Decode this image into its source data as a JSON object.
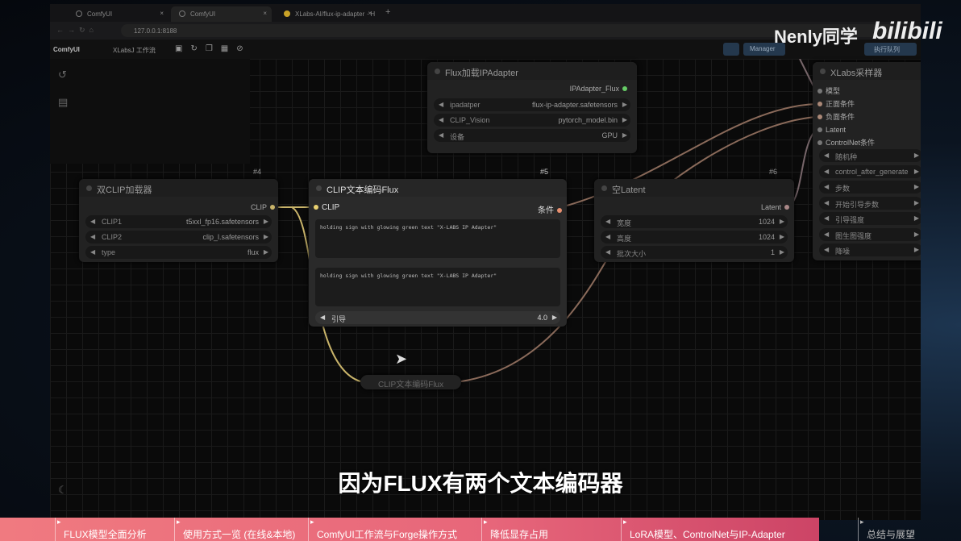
{
  "browser": {
    "tabs": [
      {
        "label": "ComfyUI"
      },
      {
        "label": "ComfyUI"
      },
      {
        "label": "XLabs-AI/flux-ip-adapter · H"
      }
    ],
    "url": "127.0.0.1:8188"
  },
  "menu": {
    "app": "ComfyUI",
    "workflow": "XLabsJ 工作流",
    "manager": "Manager",
    "queue": "执行队列"
  },
  "watermark": {
    "author": "Nenly同学",
    "logo": "bilibili"
  },
  "nodes": {
    "ipadapter": {
      "title": "Flux加载IPAdapter",
      "output": "IPAdapter_Flux",
      "widgets": [
        {
          "label": "ipadatper",
          "value": "flux-ip-adapter.safetensors"
        },
        {
          "label": "CLIP_Vision",
          "value": "pytorch_model.bin"
        },
        {
          "label": "设备",
          "value": "GPU"
        }
      ]
    },
    "dualclip": {
      "id": "#4",
      "title": "双CLIP加载器",
      "output": "CLIP",
      "widgets": [
        {
          "label": "CLIP1",
          "value": "t5xxl_fp16.safetensors"
        },
        {
          "label": "CLIP2",
          "value": "clip_l.safetensors"
        },
        {
          "label": "type",
          "value": "flux"
        }
      ]
    },
    "clipenc": {
      "id": "#5",
      "title": "CLIP文本编码Flux",
      "input": "CLIP",
      "output": "条件",
      "text1": "holding sign with glowing green text \"X-LABS IP Adapter\"",
      "text2": "holding sign with glowing green text \"X-LABS IP Adapter\"",
      "guidance_label": "引导",
      "guidance_value": "4.0"
    },
    "latent": {
      "id": "#6",
      "title": "空Latent",
      "output": "Latent",
      "widgets": [
        {
          "label": "宽度",
          "value": "1024"
        },
        {
          "label": "高度",
          "value": "1024"
        },
        {
          "label": "批次大小",
          "value": "1"
        }
      ]
    },
    "sampler": {
      "title": "XLabs采样器",
      "inputs": [
        "模型",
        "正面条件",
        "负面条件",
        "Latent",
        "ControlNet条件"
      ],
      "widgets": [
        "随机种",
        "control_after_generate",
        "步数",
        "开始引导步数",
        "引导强度",
        "图生图强度",
        "降噪"
      ]
    },
    "collapsed": {
      "title": "CLIP文本编码Flux"
    }
  },
  "subtitle": "因为FLUX有两个文本编码器",
  "chapters": [
    "FLUX模型全面分析",
    "使用方式一览 (在线&本地)",
    "ComfyUI工作流与Forge操作方式",
    "降低显存占用",
    "LoRA模型、ControlNet与IP-Adapter",
    "总结与展望"
  ]
}
